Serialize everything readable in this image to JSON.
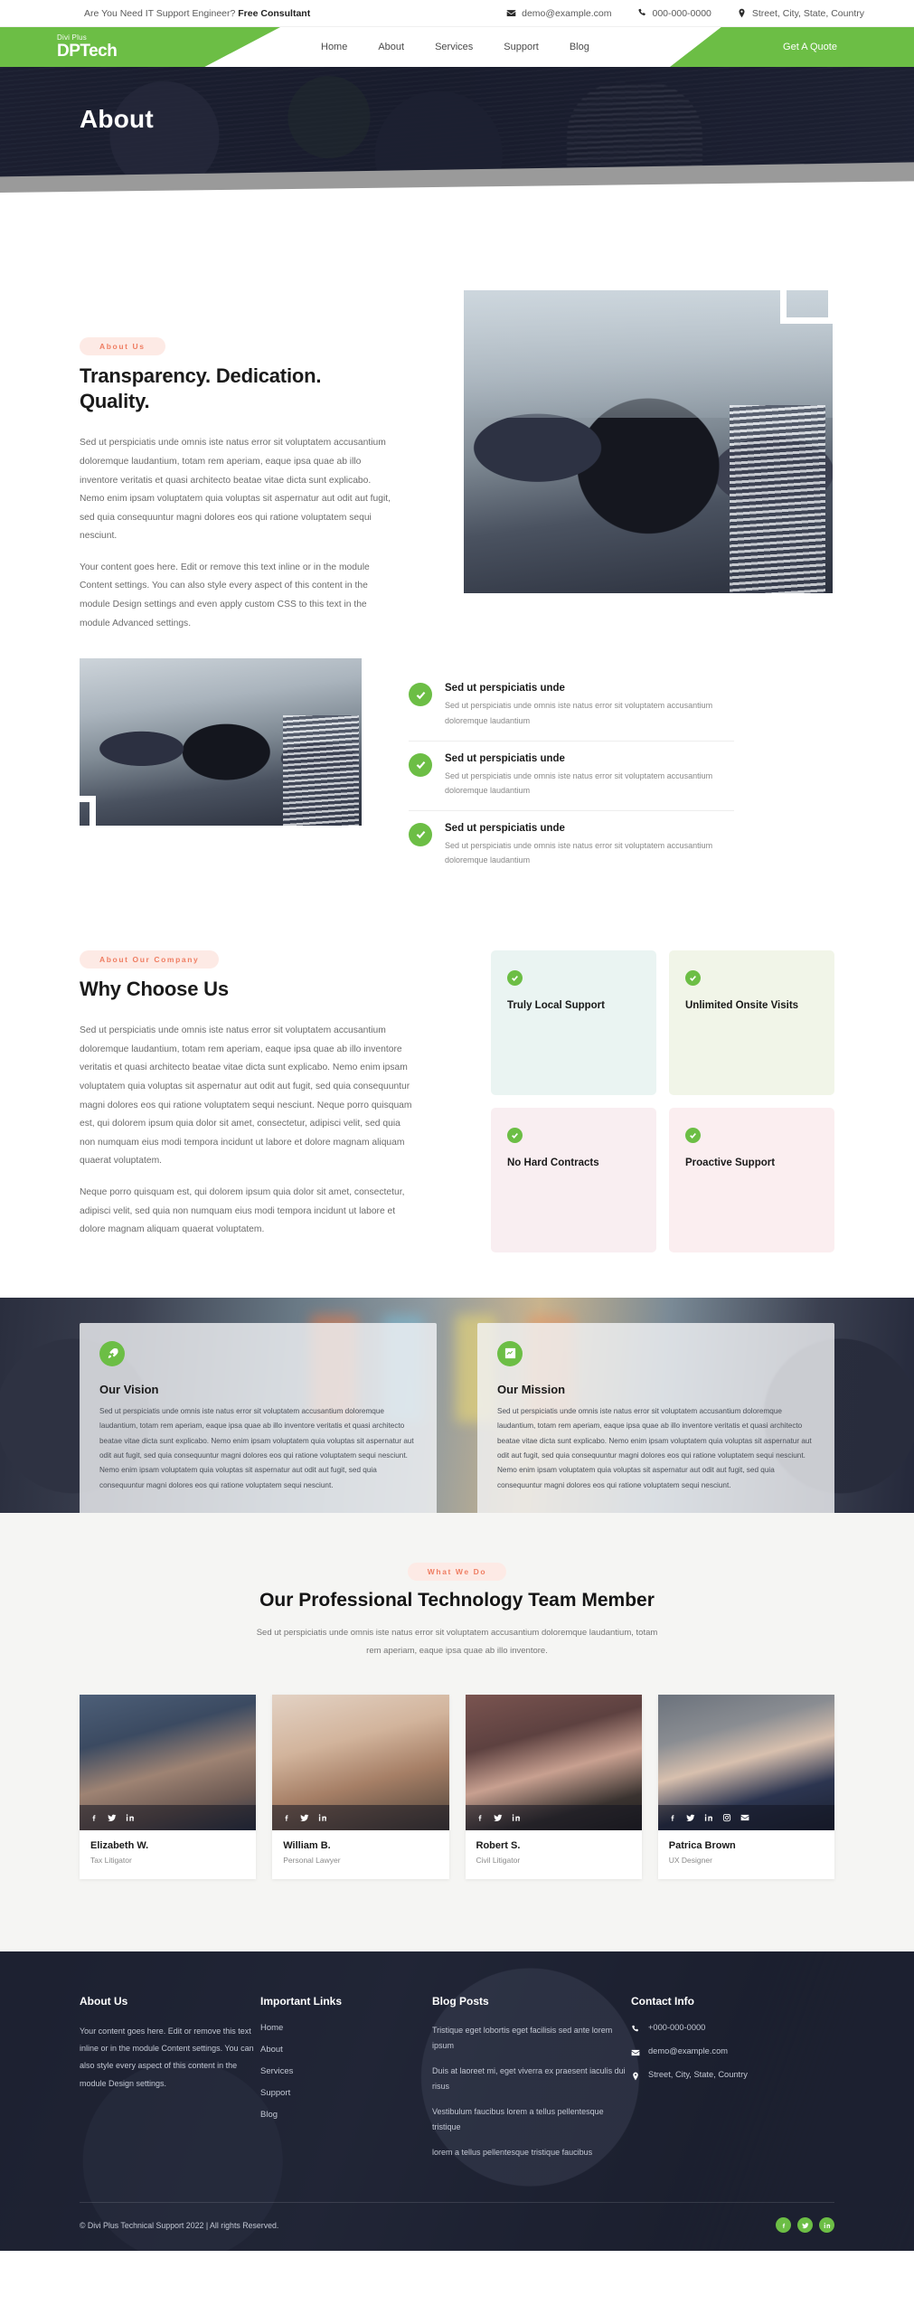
{
  "topbar": {
    "tagline_prefix": "Are You Need IT Support Engineer? ",
    "tagline_strong": "Free Consultant",
    "email": "demo@example.com",
    "phone": "000-000-0000",
    "address": "Street, City, State, Country"
  },
  "nav": {
    "logo_sub": "Divi Plus",
    "logo_main": "DPTech",
    "items": [
      {
        "label": "Home"
      },
      {
        "label": "About"
      },
      {
        "label": "Services"
      },
      {
        "label": "Support"
      },
      {
        "label": "Blog"
      }
    ],
    "cta": "Get A Quote"
  },
  "hero": {
    "title": "About"
  },
  "about": {
    "badge": "About Us",
    "title": "Transparency. Dedication. Quality.",
    "para1": "Sed ut perspiciatis unde omnis iste natus error sit voluptatem accusantium doloremque laudantium, totam rem aperiam, eaque ipsa quae ab illo inventore veritatis et quasi architecto beatae vitae dicta sunt explicabo. Nemo enim ipsam voluptatem quia voluptas sit aspernatur aut odit aut fugit, sed quia consequuntur magni dolores eos qui ratione voluptatem sequi nesciunt.",
    "para2": "Your content goes here. Edit or remove this text inline or in the module Content settings. You can also style every aspect of this content in the module Design settings and even apply custom CSS to this text in the module Advanced settings."
  },
  "checklist": [
    {
      "title": "Sed ut perspiciatis unde",
      "desc": "Sed ut perspiciatis unde omnis iste natus error sit voluptatem accusantium doloremque laudantium"
    },
    {
      "title": "Sed ut perspiciatis unde",
      "desc": "Sed ut perspiciatis unde omnis iste natus error sit voluptatem accusantium doloremque laudantium"
    },
    {
      "title": "Sed ut perspiciatis unde",
      "desc": "Sed ut perspiciatis unde omnis iste natus error sit voluptatem accusantium doloremque laudantium"
    }
  ],
  "why": {
    "badge": "About Our Company",
    "title": "Why Choose Us",
    "para1": "Sed ut perspiciatis unde omnis iste natus error sit voluptatem accusantium doloremque laudantium, totam rem aperiam, eaque ipsa quae ab illo inventore veritatis et quasi architecto beatae vitae dicta sunt explicabo. Nemo enim ipsam voluptatem quia voluptas sit aspernatur aut odit aut fugit, sed quia consequuntur magni dolores eos qui ratione voluptatem sequi nesciunt. Neque porro quisquam est, qui dolorem ipsum quia dolor sit amet, consectetur, adipisci velit, sed quia non numquam eius modi tempora incidunt ut labore et dolore magnam aliquam quaerat voluptatem.",
    "para2": "Neque porro quisquam est, qui dolorem ipsum quia dolor sit amet, consectetur, adipisci velit, sed quia non numquam eius modi tempora incidunt ut labore et dolore magnam aliquam quaerat voluptatem.",
    "features": [
      {
        "label": "Truly Local Support",
        "bg": "#eaf4f2"
      },
      {
        "label": "Unlimited Onsite Visits",
        "bg": "#f1f5e8"
      },
      {
        "label": "No Hard Contracts",
        "bg": "#f9eef1"
      },
      {
        "label": "Proactive Support",
        "bg": "#fbeef0"
      }
    ]
  },
  "vision_mission": [
    {
      "icon": "rocket-icon",
      "title": "Our Vision",
      "text": "Sed ut perspiciatis unde omnis iste natus error sit voluptatem accusantium doloremque laudantium, totam rem aperiam, eaque ipsa quae ab illo inventore veritatis et quasi architecto beatae vitae dicta sunt explicabo. Nemo enim ipsam voluptatem quia voluptas sit aspernatur aut odit aut fugit, sed quia consequuntur magni dolores eos qui ratione voluptatem sequi nesciunt. Nemo enim ipsam voluptatem quia voluptas sit aspernatur aut odit aut fugit, sed quia consequuntur magni dolores eos qui ratione voluptatem sequi nesciunt."
    },
    {
      "icon": "chart-icon",
      "title": "Our Mission",
      "text": "Sed ut perspiciatis unde omnis iste natus error sit voluptatem accusantium doloremque laudantium, totam rem aperiam, eaque ipsa quae ab illo inventore veritatis et quasi architecto beatae vitae dicta sunt explicabo. Nemo enim ipsam voluptatem quia voluptas sit aspernatur aut odit aut fugit, sed quia consequuntur magni dolores eos qui ratione voluptatem sequi nesciunt. Nemo enim ipsam voluptatem quia voluptas sit aspernatur aut odit aut fugit, sed quia consequuntur magni dolores eos qui ratione voluptatem sequi nesciunt."
    }
  ],
  "team": {
    "badge": "What We Do",
    "title": "Our Professional Technology Team Member",
    "lead": "Sed ut perspiciatis unde omnis iste natus error sit voluptatem accusantium doloremque laudantium, totam rem aperiam, eaque ipsa quae ab illo inventore.",
    "members": [
      {
        "name": "Elizabeth W.",
        "role": "Tax Litigator",
        "socials": [
          "facebook-icon",
          "twitter-icon",
          "linkedin-icon"
        ]
      },
      {
        "name": "William B.",
        "role": "Personal Lawyer",
        "socials": [
          "facebook-icon",
          "twitter-icon",
          "linkedin-icon"
        ]
      },
      {
        "name": "Robert S.",
        "role": "Civil Litigator",
        "socials": [
          "facebook-icon",
          "twitter-icon",
          "linkedin-icon"
        ]
      },
      {
        "name": "Patrica Brown",
        "role": "UX Designer",
        "socials": [
          "facebook-icon",
          "twitter-icon",
          "linkedin-icon",
          "instagram-icon",
          "email-icon"
        ]
      }
    ]
  },
  "footer": {
    "about": {
      "title": "About Us",
      "text": "Your content goes here. Edit or remove this text inline or in the module Content settings. You can also style every aspect of this content in the module Design settings."
    },
    "links": {
      "title": "Important Links",
      "items": [
        {
          "label": "Home"
        },
        {
          "label": "About"
        },
        {
          "label": "Services"
        },
        {
          "label": "Support"
        },
        {
          "label": "Blog"
        }
      ]
    },
    "posts": {
      "title": "Blog Posts",
      "items": [
        {
          "text": "Tristique eget lobortis eget facilisis sed ante lorem ipsum"
        },
        {
          "text": "Duis at laoreet mi, eget viverra ex praesent iaculis dui risus"
        },
        {
          "text": "Vestibulum faucibus lorem a tellus pellentesque tristique"
        },
        {
          "text": "lorem a tellus pellentesque tristique faucibus"
        }
      ]
    },
    "contact": {
      "title": "Contact Info",
      "phone": "+000-000-0000",
      "email": "demo@example.com",
      "address": "Street, City, State, Country"
    },
    "copyright": "© Divi Plus Technical Support 2022 | All rights Reserved.",
    "socials": [
      "facebook-icon",
      "twitter-icon",
      "linkedin-icon"
    ]
  },
  "colors": {
    "brand_green": "#6cbe45",
    "dark_navy": "#1d2131",
    "badge_pink": "#fdeae5",
    "badge_text": "#ef7e63"
  }
}
